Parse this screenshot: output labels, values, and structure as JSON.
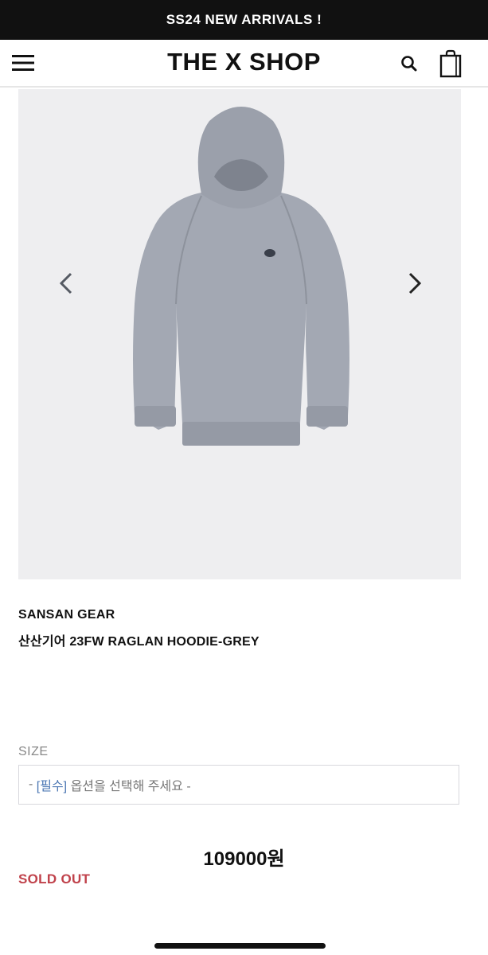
{
  "banner": {
    "text": "SS24 NEW ARRIVALS !"
  },
  "header": {
    "logo": "THE X SHOP",
    "icons": {
      "menu": "hamburger-menu-icon",
      "search": "search-icon",
      "cart": "shopping-bag-icon"
    }
  },
  "gallery": {
    "prev_icon": "chevron-left-icon",
    "next_icon": "chevron-right-icon",
    "background": "#eeeef0",
    "product_color": "#a3a8b3"
  },
  "product": {
    "brand": "SANSAN GEAR",
    "name": "산산기어 23FW RAGLAN HOODIE-GREY",
    "price": "109000원",
    "status": "SOLD OUT"
  },
  "options": {
    "size_label": "SIZE",
    "placeholder_dash_left": "- ",
    "placeholder_required": "[필수]",
    "placeholder_text": " 옵션을 선택해 주세요 -"
  },
  "colors": {
    "banner_bg": "#111111",
    "sold_out": "#c0424b",
    "required_tag": "#4d78b4"
  }
}
